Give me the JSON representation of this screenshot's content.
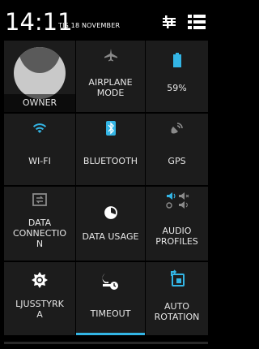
{
  "status": {
    "time": "14:11",
    "date": "TIS 18 NOVEMBER"
  },
  "header_icons": [
    "settings-sliders-icon",
    "list-menu-icon"
  ],
  "tiles": [
    {
      "label": "OWNER",
      "icon": "owner-avatar"
    },
    {
      "label": "AIRPLANE\nMODE",
      "icon": "airplane-icon"
    },
    {
      "label": "59%",
      "icon": "battery-icon"
    },
    {
      "label": "WI-FI",
      "icon": "wifi-icon"
    },
    {
      "label": "BLUETOOTH",
      "icon": "bluetooth-icon"
    },
    {
      "label": "GPS",
      "icon": "gps-icon"
    },
    {
      "label": "DATA\nCONNECTIO\nN",
      "icon": "data-connection-icon"
    },
    {
      "label": "DATA USAGE",
      "icon": "data-usage-icon"
    },
    {
      "label": "AUDIO\nPROFILES",
      "icon": "audio-profiles-icon"
    },
    {
      "label": "LJUSSTYRK\nA",
      "icon": "brightness-icon"
    },
    {
      "label": "TIMEOUT",
      "icon": "timeout-icon"
    },
    {
      "label": "AUTO\nROTATION",
      "icon": "auto-rotation-icon"
    }
  ],
  "colors": {
    "accent_blue": "#33b5e5",
    "tile_bg": "#1c1c1c",
    "label": "#e6e6e6",
    "icon_white": "#ffffff",
    "icon_dim": "#8a8a8a"
  },
  "battery": {
    "level_percent": 59
  }
}
